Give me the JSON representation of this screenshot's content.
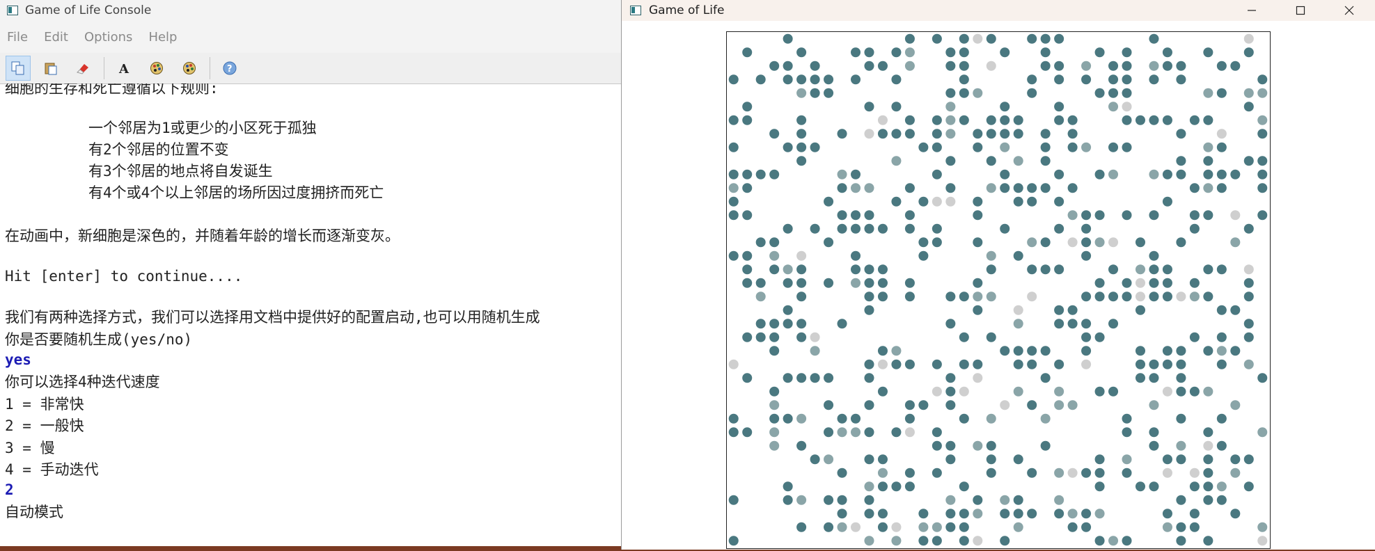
{
  "console": {
    "title": "Game of Life Console",
    "menu": [
      "File",
      "Edit",
      "Options",
      "Help"
    ],
    "toolbar_icons": [
      "copy-icon",
      "paste-icon",
      "clear-icon",
      "font-icon",
      "palette-icon",
      "palette-alt-icon",
      "help-icon"
    ],
    "lines": [
      "细胞的生存和死亡遵循以下规则:",
      "一个邻居为1或更少的小区死于孤独",
      "有2个邻居的位置不变",
      "有3个邻居的地点将自发诞生",
      "有4个或4个以上邻居的场所因过度拥挤而死亡",
      "在动画中，新细胞是深色的，并随着年龄的增长而逐渐变灰。",
      "Hit [enter] to continue....",
      "我们有两种选择方式，我们可以选择用文档中提供好的配置启动,也可以用随机生成",
      "你是否要随机生成(yes/no)",
      "yes",
      "你可以选择4种迭代速度",
      "1 = 非常快",
      "2 = 一般快",
      "3 = 慢",
      "4 = 手动迭代",
      "2",
      "自动模式"
    ]
  },
  "game": {
    "title": "Game of Life",
    "controls": [
      "minimize-icon",
      "maximize-icon",
      "close-icon"
    ],
    "colors": {
      "live": "#4a7880",
      "aging": "#8aa5a8",
      "old": "#cfcfcf"
    },
    "grid": {
      "columns": 40,
      "rows": 38,
      "cell_count_shown": "random"
    }
  }
}
